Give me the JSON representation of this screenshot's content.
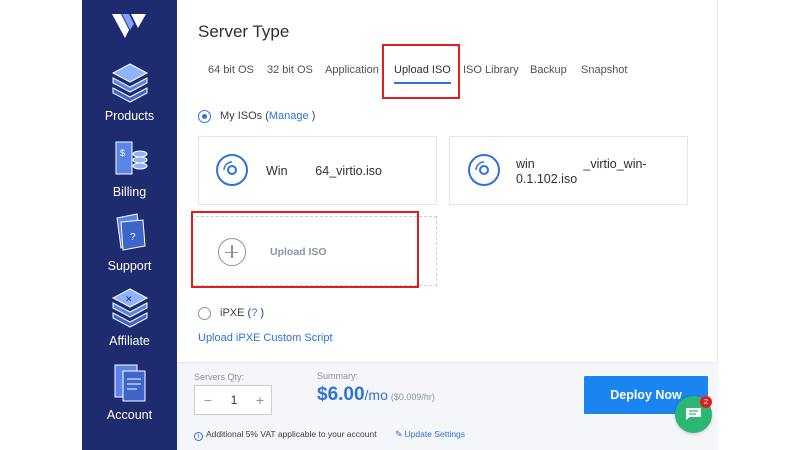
{
  "sidebar": {
    "logo_icon": "vultr-logo",
    "items": [
      {
        "label": "Products",
        "icon": "products-icon"
      },
      {
        "label": "Billing",
        "icon": "billing-icon"
      },
      {
        "label": "Support",
        "icon": "support-icon"
      },
      {
        "label": "Affiliate",
        "icon": "affiliate-icon"
      },
      {
        "label": "Account",
        "icon": "account-icon"
      }
    ]
  },
  "page": {
    "title": "Server Type"
  },
  "tabs": [
    {
      "label": "64 bit OS",
      "active": false
    },
    {
      "label": "32 bit OS",
      "active": false
    },
    {
      "label": "Application",
      "active": false
    },
    {
      "label": "Upload ISO",
      "active": true
    },
    {
      "label": "ISO Library",
      "active": false
    },
    {
      "label": "Backup",
      "active": false
    },
    {
      "label": "Snapshot",
      "active": false
    }
  ],
  "my_isos": {
    "label": "My ISOs (",
    "manage_link": "Manage",
    "close_paren": ")",
    "selected": true
  },
  "iso_cards": [
    {
      "name": "Win        64_virtio.iso",
      "icon": "disc-icon"
    },
    {
      "name_line1": "win              _virtio_win-",
      "name_line2": "0.1.102.iso",
      "icon": "disc-icon"
    }
  ],
  "upload_card": {
    "label": "Upload ISO",
    "icon": "plus-circle-icon"
  },
  "ipxe": {
    "label": "iPXE (",
    "help_link": "?",
    "close_paren": ")",
    "selected": false,
    "custom_script_link": "Upload iPXE Custom Script"
  },
  "footer": {
    "qty_label": "Servers Qty:",
    "qty_minus": "−",
    "qty_value": "1",
    "qty_plus": "+",
    "summary_label": "Summary:",
    "price": "$6.00",
    "price_unit": "/mo",
    "price_hourly": "($0.009/hr)",
    "deploy_label": "Deploy Now",
    "vat_text": "Additional 5% VAT applicable to your account",
    "update_settings_link": "Update Settings"
  },
  "chat": {
    "badge_count": "2",
    "icon": "chat-icon"
  },
  "colors": {
    "sidebar_bg": "#1e2b6e",
    "accent": "#2e73d8",
    "deploy_bg": "#1a84f0",
    "highlight_border": "#e01e1e",
    "chat_bg": "#2bb673"
  }
}
